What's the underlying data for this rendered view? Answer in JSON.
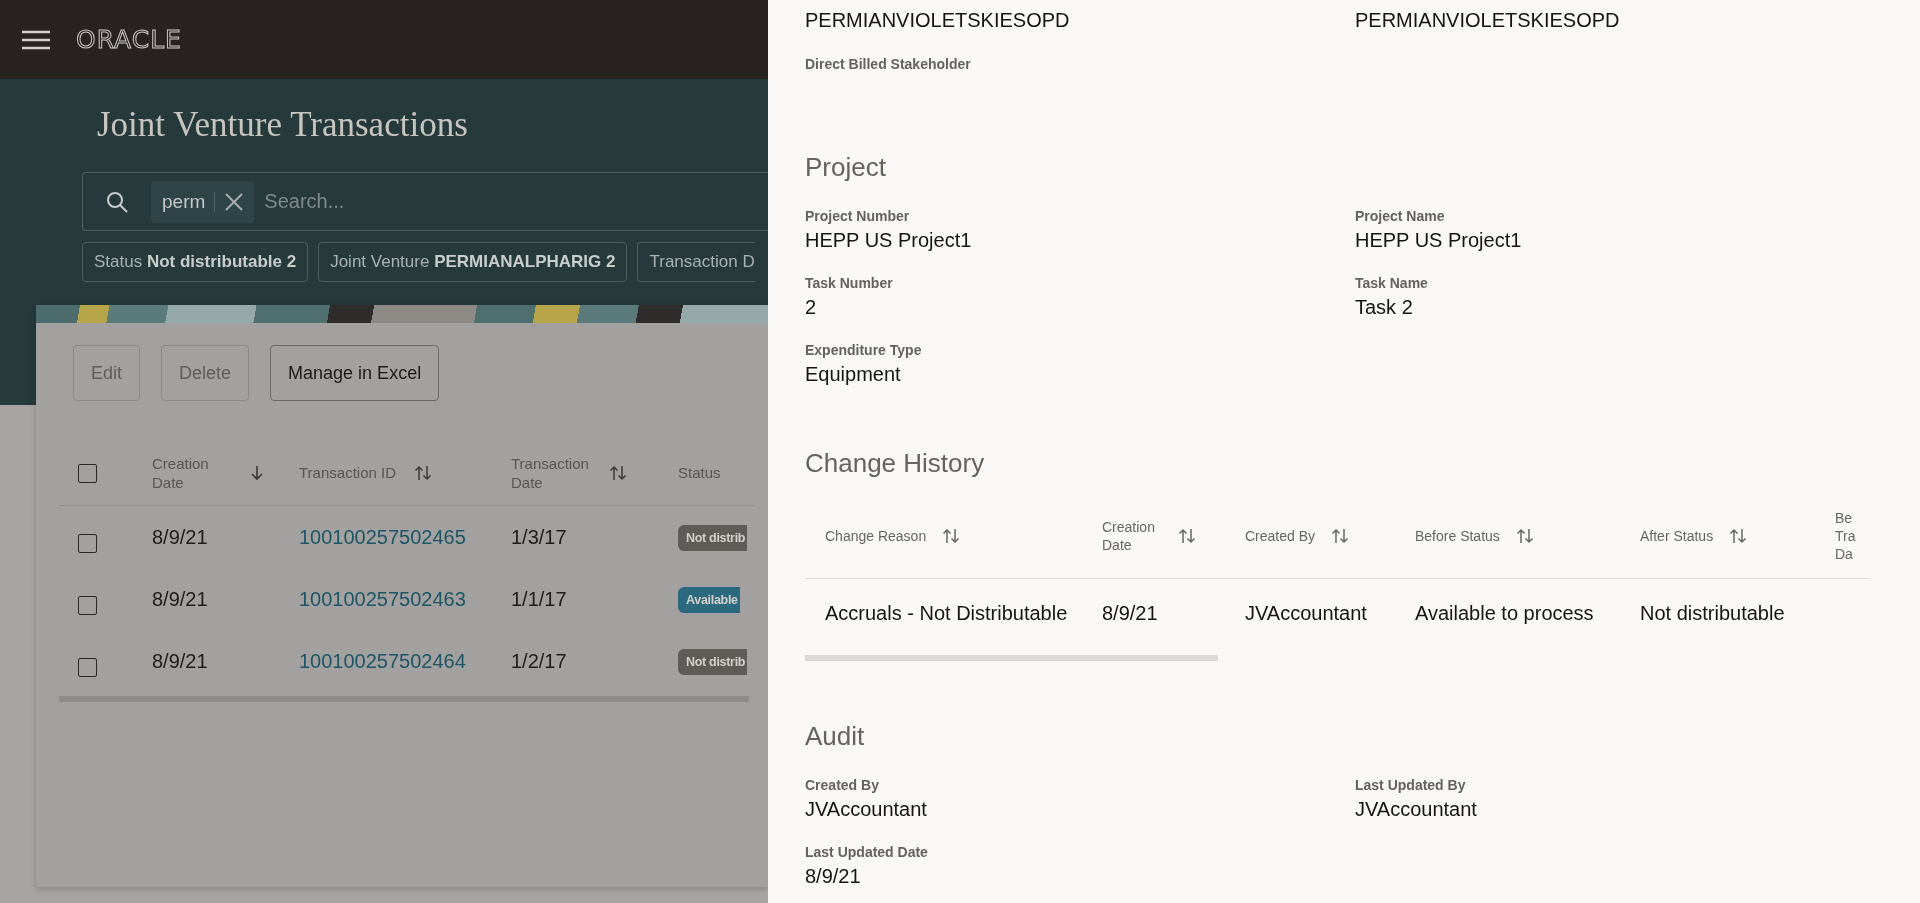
{
  "header": {
    "logo": "ORACLE"
  },
  "page": {
    "title": "Joint Venture Transactions",
    "search": {
      "chips": [
        "perm"
      ],
      "placeholder": "Search..."
    },
    "filters": [
      "Status **Not distributable 2**",
      "Joint Venture **PERMIANALPHARIG 2**",
      "Transaction D"
    ],
    "toolbar": [
      {
        "label": "Edit",
        "disabled": true
      },
      {
        "label": "Delete",
        "disabled": true
      },
      {
        "label": "Manage in Excel",
        "disabled": false
      }
    ],
    "table": {
      "select_all_checked": false,
      "columns": [
        {
          "label": "Creation Date",
          "sorted": true
        },
        {
          "label": "Transaction ID",
          "sorted": false
        },
        {
          "label": "Transaction Date",
          "sorted": false
        },
        {
          "label": "Status"
        }
      ],
      "rows": [
        {
          "checked": false,
          "creation_date": "8/9/21",
          "transaction_id": "100100257502465",
          "transaction_date": "1/3/17",
          "status": {
            "text": "Not distrib",
            "kind": "neutral"
          }
        },
        {
          "checked": false,
          "creation_date": "8/9/21",
          "transaction_id": "100100257502463",
          "transaction_date": "1/1/17",
          "status": {
            "text": "Available",
            "kind": "info"
          }
        },
        {
          "checked": false,
          "creation_date": "8/9/21",
          "transaction_id": "100100257502464",
          "transaction_date": "1/2/17",
          "status": {
            "text": "Not distrib",
            "kind": "neutral"
          }
        }
      ]
    }
  },
  "drawer": {
    "sections": [
      {
        "kind": "fields",
        "fields": [
          {
            "value": "PERMIANVIOLETSKIESOPD"
          },
          {
            "value": "PERMIANVIOLETSKIESOPD"
          },
          {
            "label": "Direct Billed Stakeholder"
          }
        ]
      },
      {
        "kind": "fields",
        "heading": "Project",
        "fields": [
          {
            "label": "Project Number",
            "value": "HEPP US Project1"
          },
          {
            "label": "Project Name",
            "value": "HEPP US Project1"
          },
          {
            "label": "Task Number",
            "value": "2"
          },
          {
            "label": "Task Name",
            "value": "Task 2"
          },
          {
            "label": "Expenditure Type",
            "value": "Equipment"
          }
        ]
      },
      {
        "kind": "table",
        "heading": "Change History",
        "columns": [
          {
            "label": "Change Reason",
            "sorted": false
          },
          {
            "label": "Creation Date",
            "sorted": false
          },
          {
            "label": "Created By",
            "sorted": false
          },
          {
            "label": "Before Status",
            "sorted": false
          },
          {
            "label": "After Status",
            "sorted": false
          },
          {
            "label": "Be Tra Da"
          }
        ],
        "rows": [
          [
            "Accruals - Not Distributable",
            "8/9/21",
            "JVAccountant",
            "Available to process",
            "Not distributable"
          ]
        ]
      },
      {
        "kind": "fields",
        "heading": "Audit",
        "fields": [
          {
            "label": "Created By",
            "value": "JVAccountant"
          },
          {
            "label": "Last Updated By",
            "value": "JVAccountant"
          },
          {
            "label": "Last Updated Date",
            "value": "8/9/21"
          }
        ]
      }
    ]
  }
}
